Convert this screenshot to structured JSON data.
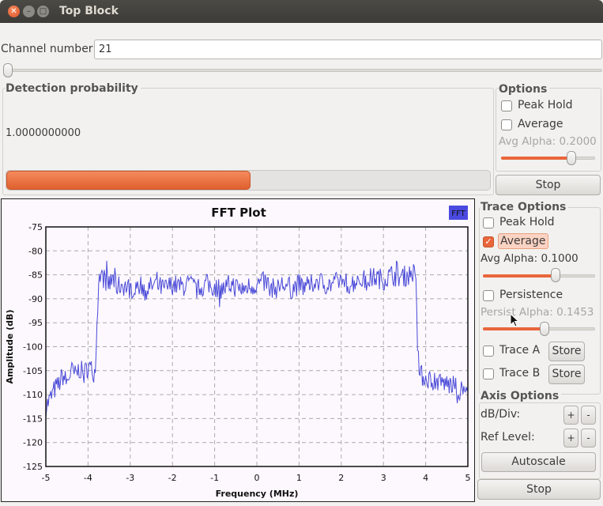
{
  "window": {
    "title": "Top Block"
  },
  "channel": {
    "label": "Channel number:",
    "value": "21",
    "slider_fraction": 0.0
  },
  "detection": {
    "title": "Detection probability",
    "value_text": "1.0000000000",
    "progress_fraction": 0.505
  },
  "options": {
    "title": "Options",
    "peak_hold_label": "Peak Hold",
    "peak_hold_checked": false,
    "average_label": "Average",
    "average_checked": false,
    "avg_alpha_label": "Avg Alpha: 0.2000",
    "avg_alpha_fraction": 0.75,
    "stop_label": "Stop"
  },
  "trace_options": {
    "title": "Trace Options",
    "peak_hold_label": "Peak Hold",
    "peak_hold_checked": false,
    "average_label": "Average",
    "average_checked": true,
    "avg_alpha_label": "Avg Alpha: 0.1000",
    "avg_alpha_fraction": 0.65,
    "persistence_label": "Persistence",
    "persistence_checked": false,
    "persist_alpha_label": "Persist Alpha: 0.1453",
    "persist_alpha_fraction": 0.55,
    "trace_a_label": "Trace A",
    "trace_b_label": "Trace B",
    "store_label": "Store"
  },
  "axis_options": {
    "title": "Axis Options",
    "db_div_label": "dB/Div:",
    "ref_level_label": "Ref Level:",
    "plus_label": "+",
    "minus_label": "-",
    "autoscale_label": "Autoscale"
  },
  "plot_stop_label": "Stop",
  "chart_data": {
    "type": "line",
    "title": "FFT Plot",
    "legend": [
      "FFT"
    ],
    "legend_placement": "top-right",
    "xlabel": "Frequency (MHz)",
    "ylabel": "Amplitude (dB)",
    "xlim": [
      -5,
      5
    ],
    "ylim": [
      -125,
      -75
    ],
    "xticks": [
      "-5",
      "-4",
      "-3",
      "-2",
      "-1",
      "0",
      "1",
      "2",
      "3",
      "4",
      "5"
    ],
    "yticks": [
      "-75",
      "-80",
      "-85",
      "-90",
      "-95",
      "-100",
      "-105",
      "-110",
      "-115",
      "-120",
      "-125"
    ],
    "grid": true,
    "series_color": "#4a4ad8",
    "series": [
      {
        "name": "FFT",
        "x": [
          -5.0,
          -4.9,
          -4.8,
          -4.7,
          -4.6,
          -4.5,
          -4.4,
          -4.3,
          -4.2,
          -4.1,
          -4.0,
          -3.9,
          -3.82,
          -3.8,
          -3.75,
          -3.7,
          -3.6,
          -3.5,
          -3.4,
          -3.3,
          -3.2,
          -3.0,
          -2.8,
          -2.6,
          -2.4,
          -2.2,
          -2.0,
          -1.8,
          -1.6,
          -1.4,
          -1.2,
          -1.0,
          -0.8,
          -0.6,
          -0.4,
          -0.2,
          0.0,
          0.2,
          0.4,
          0.6,
          0.8,
          1.0,
          1.2,
          1.4,
          1.6,
          1.8,
          2.0,
          2.2,
          2.4,
          2.6,
          2.8,
          3.0,
          3.2,
          3.4,
          3.6,
          3.7,
          3.75,
          3.78,
          3.8,
          3.85,
          3.9,
          4.0,
          4.2,
          4.4,
          4.6,
          4.8,
          5.0
        ],
        "y": [
          -112.5,
          -111,
          -109,
          -108,
          -106,
          -107.5,
          -105,
          -106,
          -104.5,
          -106,
          -104,
          -105,
          -105.5,
          -98,
          -86,
          -85,
          -86,
          -87,
          -86,
          -87.5,
          -87,
          -88,
          -87,
          -88,
          -87,
          -88,
          -87,
          -87.5,
          -87,
          -88,
          -87,
          -87.5,
          -88,
          -87,
          -88,
          -87.5,
          -87,
          -86.5,
          -88,
          -87,
          -88,
          -87,
          -88,
          -86,
          -87,
          -87,
          -86,
          -87,
          -86,
          -86,
          -85.5,
          -86,
          -85,
          -85.5,
          -85,
          -84.5,
          -85.5,
          -86,
          -100,
          -105,
          -106,
          -106.5,
          -107,
          -107.5,
          -108,
          -109,
          -109.5
        ]
      }
    ]
  }
}
